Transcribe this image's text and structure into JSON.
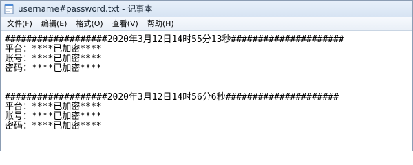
{
  "window": {
    "title": "username#password.txt - 记事本",
    "icon": "notepad-icon"
  },
  "menu": [
    {
      "label": "文件(F)"
    },
    {
      "label": "编辑(E)"
    },
    {
      "label": "格式(O)"
    },
    {
      "label": "查看(V)"
    },
    {
      "label": "帮助(H)"
    }
  ],
  "content": {
    "block1": {
      "header": "###################2020年3月12日14时55分13秒#####################",
      "platform": "平台：****已加密****",
      "account": "账号：****已加密****",
      "password": "密码：****已加密****"
    },
    "block2": {
      "header": "###################2020年3月12日14时56分6秒#####################",
      "platform": "平台：****已加密****",
      "account": "账号：****已加密****",
      "password": "密码：****已加密****"
    }
  }
}
